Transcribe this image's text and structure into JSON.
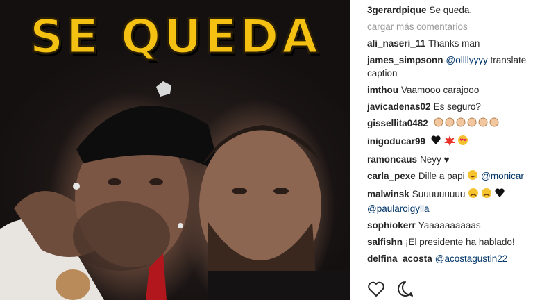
{
  "post": {
    "overlay_text": "SE QUEDA"
  },
  "caption": {
    "user": "3gerardpique",
    "text": "Se queda."
  },
  "load_more_label": "cargar más comentarios",
  "comments": [
    {
      "user": "ali_naseri_11",
      "text": "Thanks man"
    },
    {
      "user": "james_simpsonn",
      "mention": "@ollllyyyy",
      "text": " translate caption"
    },
    {
      "user": "imthou",
      "text": "Vaamooo carajooo"
    },
    {
      "user": "javicadenas02",
      "text": "Es seguro?"
    },
    {
      "user": "gissellita0482",
      "emoji": "clapping-hands-x6"
    },
    {
      "user": "inigoducar99",
      "emoji": "heart-collision-heart-eyes"
    },
    {
      "user": "ramoncaus",
      "text": "Neyy ♥"
    },
    {
      "user": "carla_pexe",
      "text": "Dille a papi",
      "mention": " @monicar"
    },
    {
      "user": "malwinsk",
      "text": "Suuuuuuuuu",
      "mention": "@paularoigylla"
    },
    {
      "user": "sophiokerr",
      "text": "Yaaaaaaaaaas"
    },
    {
      "user": "salfishn",
      "text": "¡El presidente ha hablado!"
    },
    {
      "user": "delfina_acosta",
      "mention": "@acostagustin22"
    }
  ],
  "actions": {
    "like_icon": "heart-outline-icon",
    "comment_icon": "speech-bubble-icon"
  },
  "colors": {
    "overlay_yellow": "#f4c112",
    "mention_blue": "#003569",
    "muted_gray": "#999999"
  }
}
